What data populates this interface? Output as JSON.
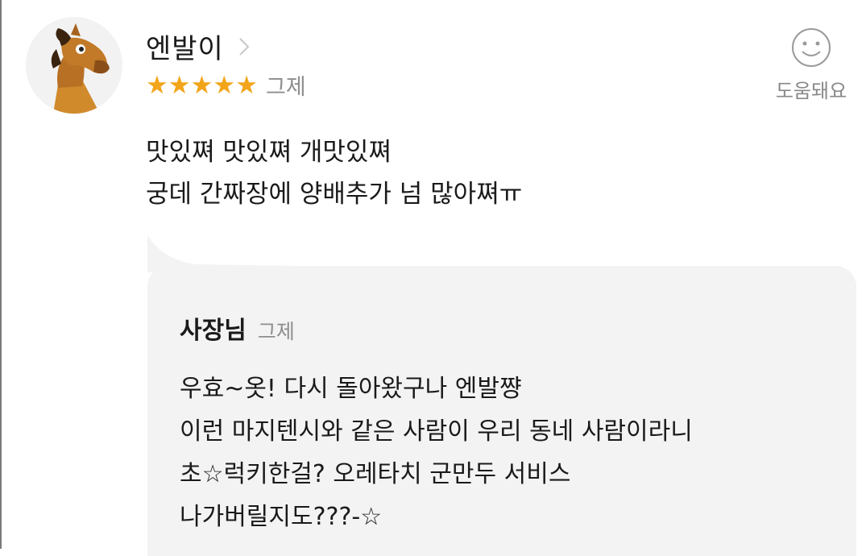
{
  "review": {
    "nickname": "엔발이",
    "rating": 5,
    "stars": [
      "★",
      "★",
      "★",
      "★",
      "★"
    ],
    "date": "그제",
    "helpful_label": "도움돼요",
    "lines": [
      "맛있쪄 맛있쪄 개맛있쪄",
      "궁데 간짜장에 양배추가 넘 많아쪄ㅠ"
    ]
  },
  "reply": {
    "author": "사장님",
    "date": "그제",
    "lines": [
      "우효~옷! 다시 돌아왔구나 엔발쨩",
      "이런 마지텐시와 같은 사람이 우리 동네 사람이라니",
      "초☆럭키한걸? 오레타치 군만두 서비스",
      "나가버릴지도???-☆"
    ]
  },
  "colors": {
    "star": "#f2a51a",
    "reply_bg": "#f3f3f3",
    "muted_text": "#8e8e8e"
  },
  "icons": [
    "horse-avatar",
    "chevron-right-icon",
    "star-icon",
    "smiley-icon"
  ]
}
